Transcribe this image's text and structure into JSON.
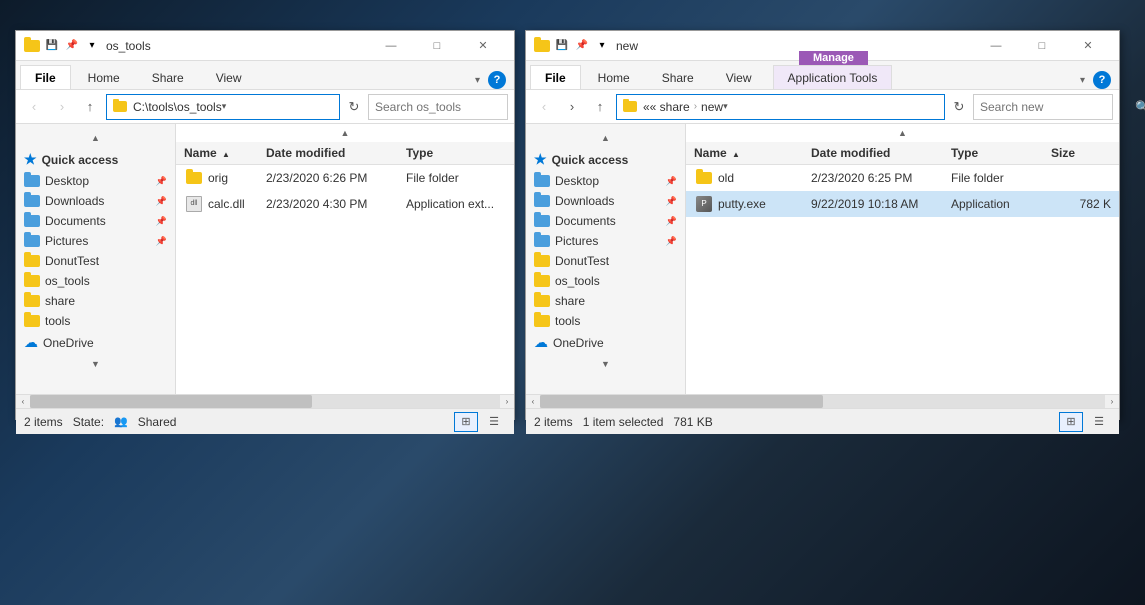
{
  "window1": {
    "title": "os_tools",
    "address": "C:\\tools\\os_tools",
    "search_placeholder": "Search os_tools",
    "tabs": [
      "File",
      "Home",
      "Share",
      "View"
    ],
    "active_tab": "File",
    "columns": [
      "Name",
      "Date modified",
      "Type"
    ],
    "files": [
      {
        "name": "orig",
        "date": "2/23/2020 6:26 PM",
        "type": "File folder",
        "size": "",
        "icon": "folder"
      },
      {
        "name": "calc.dll",
        "date": "2/23/2020 4:30 PM",
        "type": "Application ext...",
        "size": "",
        "icon": "dll"
      }
    ],
    "status": {
      "count": "2 items",
      "state_label": "State:",
      "state_icon": "shared",
      "state_value": "Shared"
    },
    "sidebar": {
      "items": [
        {
          "label": "Quick access",
          "icon": "star",
          "type": "header"
        },
        {
          "label": "Desktop",
          "icon": "desktop-folder",
          "pin": true
        },
        {
          "label": "Downloads",
          "icon": "downloads-folder",
          "pin": true
        },
        {
          "label": "Documents",
          "icon": "documents-folder",
          "pin": true
        },
        {
          "label": "Pictures",
          "icon": "pictures-folder",
          "pin": true
        },
        {
          "label": "DonutTest",
          "icon": "yellow-folder",
          "pin": false
        },
        {
          "label": "os_tools",
          "icon": "yellow-folder",
          "pin": false
        },
        {
          "label": "share",
          "icon": "yellow-folder",
          "pin": false
        },
        {
          "label": "tools",
          "icon": "yellow-folder",
          "pin": false
        },
        {
          "label": "OneDrive",
          "icon": "cloud",
          "pin": false
        }
      ]
    }
  },
  "window2": {
    "title": "new",
    "breadcrumb": [
      "«« share",
      "›",
      "new"
    ],
    "search_placeholder": "Search new",
    "tabs": [
      "File",
      "Home",
      "Share",
      "View"
    ],
    "manage_tab": "Application Tools",
    "active_tab": "File",
    "columns": [
      "Name",
      "Date modified",
      "Type",
      "Size"
    ],
    "files": [
      {
        "name": "old",
        "date": "2/23/2020 6:25 PM",
        "type": "File folder",
        "size": "",
        "icon": "folder",
        "selected": false
      },
      {
        "name": "putty.exe",
        "date": "9/22/2019 10:18 AM",
        "type": "Application",
        "size": "782 K",
        "icon": "putty",
        "selected": true
      }
    ],
    "status": {
      "count": "2 items",
      "selected": "1 item selected",
      "size": "781 KB"
    },
    "sidebar": {
      "items": [
        {
          "label": "Quick access",
          "icon": "star",
          "type": "header"
        },
        {
          "label": "Desktop",
          "icon": "desktop-folder",
          "pin": true
        },
        {
          "label": "Downloads",
          "icon": "downloads-folder",
          "pin": true
        },
        {
          "label": "Documents",
          "icon": "documents-folder",
          "pin": true
        },
        {
          "label": "Pictures",
          "icon": "pictures-folder",
          "pin": true
        },
        {
          "label": "DonutTest",
          "icon": "yellow-folder",
          "pin": false
        },
        {
          "label": "os_tools",
          "icon": "yellow-folder",
          "pin": false
        },
        {
          "label": "share",
          "icon": "yellow-folder",
          "pin": false
        },
        {
          "label": "tools",
          "icon": "yellow-folder",
          "pin": false
        },
        {
          "label": "OneDrive",
          "icon": "cloud",
          "pin": false
        }
      ]
    }
  },
  "icons": {
    "back": "‹",
    "forward": "›",
    "up": "↑",
    "minimize": "—",
    "maximize": "□",
    "close": "✕",
    "dropdown": "▾",
    "refresh": "↻",
    "search": "🔍",
    "pin": "📌",
    "star": "★",
    "cloud": "☁",
    "grid": "⊞",
    "list": "☰",
    "sort_asc": "▲",
    "shared_user": "👥"
  }
}
